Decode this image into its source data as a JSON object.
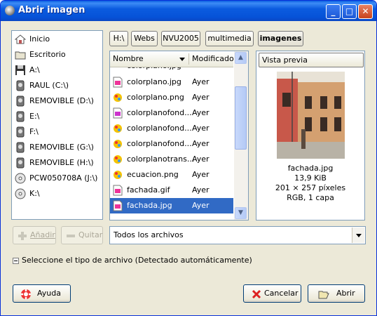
{
  "window": {
    "title": "Abrir imagen"
  },
  "places": [
    {
      "label": "Inicio",
      "icon": "home-icon"
    },
    {
      "label": "Escritorio",
      "icon": "folder-icon"
    },
    {
      "label": "A:\\",
      "icon": "floppy-icon"
    },
    {
      "label": "RAUL (C:\\)",
      "icon": "hard-drive-icon"
    },
    {
      "label": "REMOVIBLE (D:\\)",
      "icon": "hard-drive-icon"
    },
    {
      "label": "E:\\",
      "icon": "hard-drive-icon"
    },
    {
      "label": "F:\\",
      "icon": "hard-drive-icon"
    },
    {
      "label": "REMOVIBLE (G:\\)",
      "icon": "hard-drive-icon"
    },
    {
      "label": "REMOVIBLE (H:\\)",
      "icon": "hard-drive-icon"
    },
    {
      "label": "PCW050708A (J:\\)",
      "icon": "cd-icon"
    },
    {
      "label": "K:\\",
      "icon": "cd-icon"
    }
  ],
  "path": [
    "H:\\",
    "Webs",
    "NVU2005",
    "multimedia",
    "imagenes"
  ],
  "files": {
    "header": {
      "name": "Nombre",
      "modified": "Modificado"
    },
    "rows": [
      {
        "name": "colorplano.jpg",
        "modified": "Ayer"
      },
      {
        "name": "colorplano.png",
        "modified": "Ayer"
      },
      {
        "name": "colorplanofond...",
        "modified": "Ayer"
      },
      {
        "name": "colorplanofond...",
        "modified": "Ayer"
      },
      {
        "name": "colorplanofond...",
        "modified": "Ayer"
      },
      {
        "name": "colorplanotrans...",
        "modified": "Ayer"
      },
      {
        "name": "ecuacion.png",
        "modified": "Ayer"
      },
      {
        "name": "fachada.gif",
        "modified": "Ayer"
      },
      {
        "name": "fachada.jpg",
        "modified": "Ayer"
      }
    ],
    "selected": "fachada.jpg"
  },
  "preview": {
    "label": "Vista previa",
    "filename": "fachada.jpg",
    "size": "13,9 KiB",
    "dimensions": "201 × 257 píxeles",
    "info": "RGB, 1 capa"
  },
  "buttons": {
    "add": "Añadir",
    "remove": "Quitar",
    "help": "Ayuda",
    "cancel": "Cancelar",
    "open": "Abrir"
  },
  "filter": {
    "value": "Todos los archivos"
  },
  "expander": {
    "label": "Seleccione el tipo de archivo  (Detectado automáticamente)"
  },
  "colors": {
    "titlebar": "#0a5ee0",
    "selection": "#316ac5",
    "window_bg": "#ece9d8"
  }
}
